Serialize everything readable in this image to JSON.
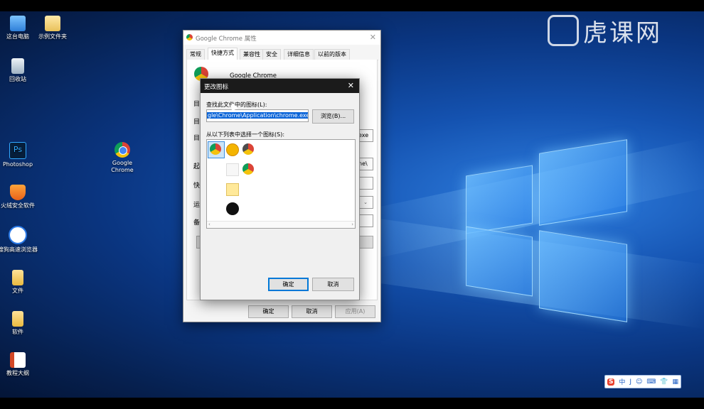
{
  "watermark": "虎课网",
  "desktop_icons": [
    {
      "name": "this-pc",
      "label": "这台电脑"
    },
    {
      "name": "sample-folder",
      "label": "示例文件夹"
    },
    {
      "name": "recycle-bin",
      "label": "回收站"
    },
    {
      "name": "photoshop",
      "label": "Photoshop"
    },
    {
      "name": "google-chrome",
      "label": "Google Chrome"
    },
    {
      "name": "huorong",
      "label": "火绒安全软件"
    },
    {
      "name": "sogou-browser",
      "label": "搜狗高速浏览器"
    },
    {
      "name": "files-folder",
      "label": "文件"
    },
    {
      "name": "software-folder",
      "label": "软件"
    },
    {
      "name": "lesson-outline",
      "label": "教程大纲"
    }
  ],
  "properties_window": {
    "title": "Google Chrome 属性",
    "tabs": [
      "常规",
      "快捷方式",
      "兼容性",
      "安全",
      "详细信息",
      "以前的版本"
    ],
    "app_name": "Google Chrome",
    "side_labels": [
      "目",
      "目",
      "目",
      "起",
      "快",
      "运",
      "备"
    ],
    "side_value_fragments": [
      "exe",
      "ne\\"
    ],
    "buttons": {
      "ok": "确定",
      "cancel": "取消",
      "apply": "应用(A)"
    }
  },
  "dialog": {
    "title": "更改图标",
    "find_label": "查找此文件中的图标(L):",
    "path_value": "gle\\Chrome\\Application\\chrome.exe",
    "browse_label": "浏览(B)...",
    "list_label": "从以下列表中选择一个图标(S):",
    "ok_label": "确定",
    "cancel_label": "取消"
  },
  "ime_toolbar": {
    "items": [
      "S",
      "中",
      "J",
      "☺",
      "⌨",
      "👕",
      "▦"
    ]
  }
}
